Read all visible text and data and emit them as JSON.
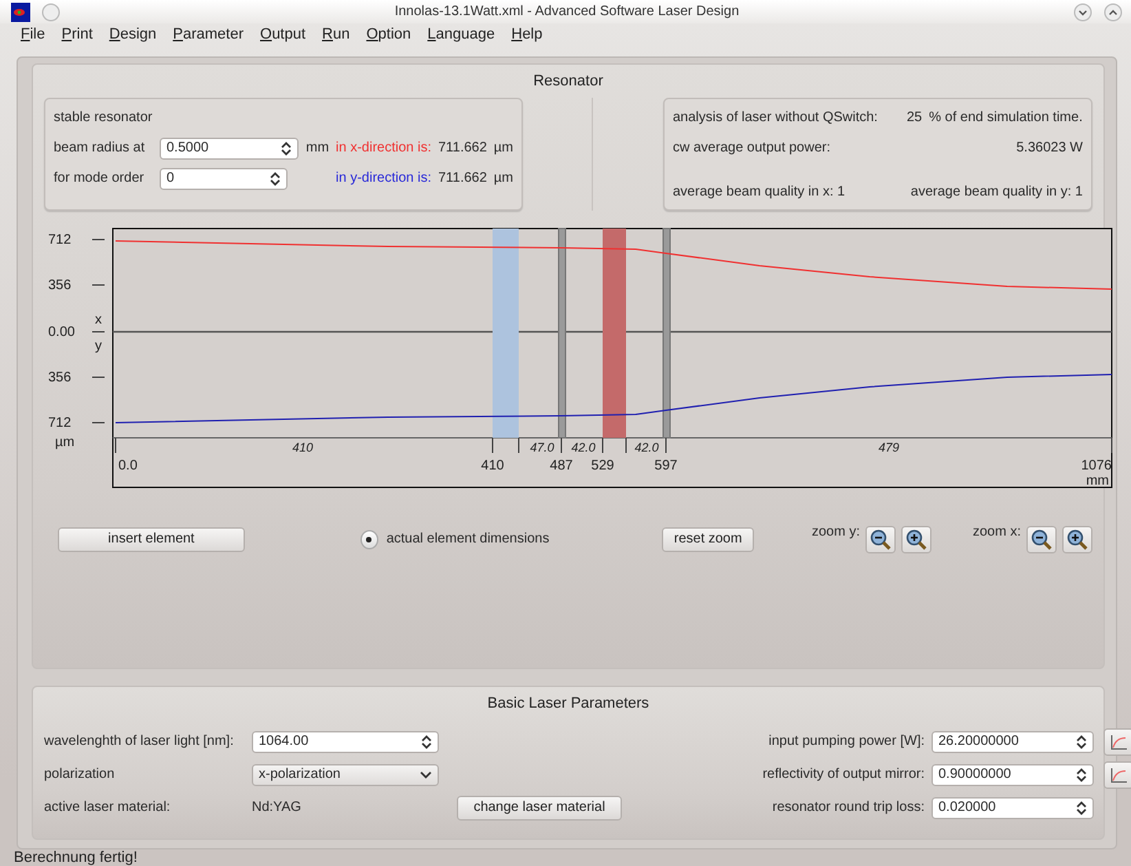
{
  "window": {
    "title": "Innolas-13.1Watt.xml - Advanced Software Laser Design"
  },
  "menu": [
    "File",
    "Print",
    "Design",
    "Parameter",
    "Output",
    "Run",
    "Option",
    "Language",
    "Help"
  ],
  "resonator": {
    "title": "Resonator",
    "mode_label": "stable resonator",
    "beam_radius_label": "beam radius at",
    "beam_radius_value": "0.5000",
    "beam_radius_unit": "mm",
    "x_direction_label": "in x-direction is:",
    "x_value": "711.662",
    "x_unit": "µm",
    "mode_order_label": "for mode order",
    "mode_order_value": "0",
    "y_direction_label": "in y-direction is:",
    "y_value": "711.662",
    "y_unit": "µm"
  },
  "analysis": {
    "label": "analysis of laser without QSwitch:",
    "percent": "25",
    "percent_text": "% of end simulation time.",
    "power_label": "cw average output power:",
    "power_value": "5.36023 W",
    "quality_x": "average beam quality in x: 1",
    "quality_y": "average beam quality in y: 1"
  },
  "plot": {
    "y_ticks": [
      "712",
      "356",
      "0.00",
      "356",
      "712"
    ],
    "y_unit": "µm",
    "x_axis_label": "x",
    "y_axis_label": "y",
    "positions": [
      "0.0",
      "410",
      "487",
      "529",
      "597",
      "1076"
    ],
    "x_unit": "mm",
    "segments": [
      "410",
      "47.0",
      "42.0",
      "42.0",
      "479"
    ],
    "elements": [
      {
        "kind": "band",
        "color": "#adc3de"
      },
      {
        "kind": "mirror",
        "color": "#9a9a9a"
      },
      {
        "kind": "band",
        "color": "#c46a6a"
      },
      {
        "kind": "mirror",
        "color": "#9a9a9a"
      }
    ]
  },
  "controls": {
    "insert": "insert element",
    "dimensions": {
      "label": "actual element dimensions",
      "checked": true
    },
    "reset": "reset zoom",
    "zoom_y": "zoom y:",
    "zoom_x": "zoom x:"
  },
  "basic": {
    "title": "Basic Laser Parameters",
    "wavelength_label": "wavelenghth of laser light [nm]:",
    "wavelength_value": "1064.00",
    "polarization_label": "polarization",
    "polarization_value": "x-polarization",
    "material_label": "active laser material:",
    "material_value": "Nd:YAG",
    "change_material": "change laser material",
    "right_fields": [
      {
        "label": "input pumping power [W]:",
        "value": "26.20000000",
        "has_plot": true
      },
      {
        "label": "reflectivity of output mirror:",
        "value": "0.90000000",
        "has_plot": true
      },
      {
        "label": "resonator round trip loss:",
        "value": "0.020000",
        "has_plot": false
      }
    ]
  },
  "status": "Berechnung fertig!"
}
